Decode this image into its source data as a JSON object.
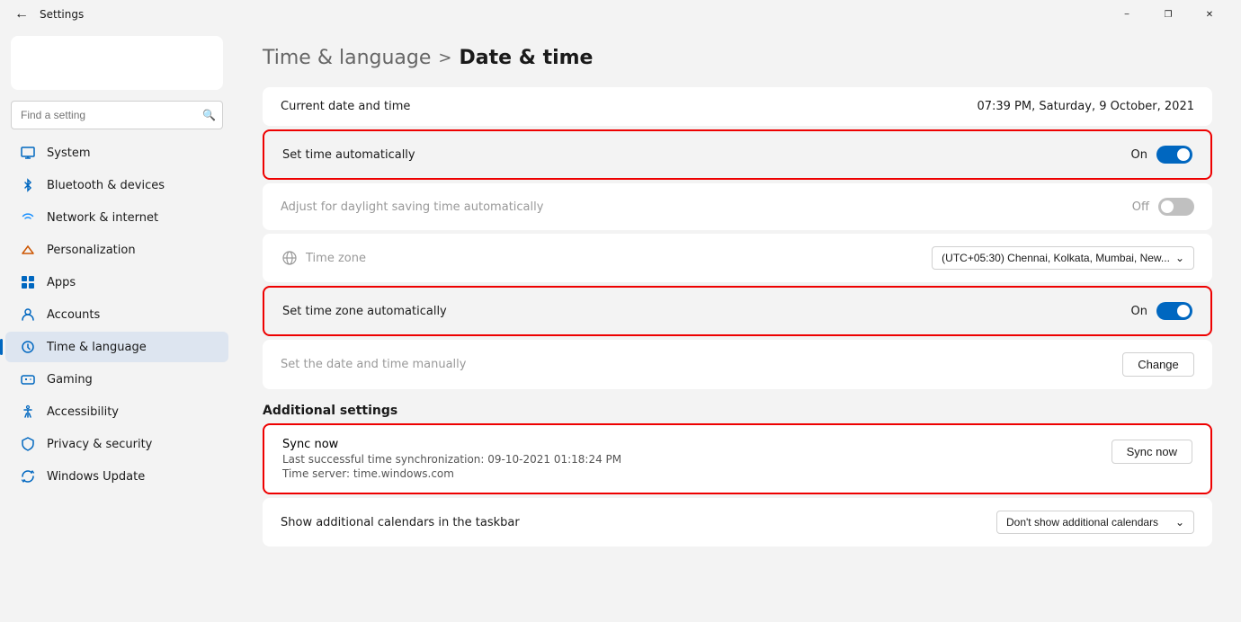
{
  "titlebar": {
    "title": "Settings",
    "minimize_label": "−",
    "restore_label": "❐",
    "close_label": "✕"
  },
  "sidebar": {
    "search_placeholder": "Find a setting",
    "items": [
      {
        "id": "system",
        "label": "System",
        "icon": "system"
      },
      {
        "id": "bluetooth",
        "label": "Bluetooth & devices",
        "icon": "bluetooth"
      },
      {
        "id": "network",
        "label": "Network & internet",
        "icon": "network"
      },
      {
        "id": "personalization",
        "label": "Personalization",
        "icon": "personalization"
      },
      {
        "id": "apps",
        "label": "Apps",
        "icon": "apps"
      },
      {
        "id": "accounts",
        "label": "Accounts",
        "icon": "accounts"
      },
      {
        "id": "time",
        "label": "Time & language",
        "icon": "time",
        "active": true
      },
      {
        "id": "gaming",
        "label": "Gaming",
        "icon": "gaming"
      },
      {
        "id": "accessibility",
        "label": "Accessibility",
        "icon": "accessibility"
      },
      {
        "id": "privacy",
        "label": "Privacy & security",
        "icon": "privacy"
      },
      {
        "id": "update",
        "label": "Windows Update",
        "icon": "update"
      }
    ]
  },
  "breadcrumb": {
    "parent": "Time & language",
    "separator": ">",
    "current": "Date & time"
  },
  "content": {
    "current_time_label": "Current date and time",
    "current_time_value": "07:39 PM, Saturday, 9 October, 2021",
    "set_time_auto_label": "Set time automatically",
    "set_time_auto_state": "On",
    "set_time_auto_on": true,
    "daylight_label": "Adjust for daylight saving time automatically",
    "daylight_state": "Off",
    "daylight_on": false,
    "timezone_label": "Time zone",
    "timezone_value": "(UTC+05:30) Chennai, Kolkata, Mumbai, New...",
    "set_timezone_auto_label": "Set time zone automatically",
    "set_timezone_auto_state": "On",
    "set_timezone_auto_on": true,
    "set_manual_label": "Set the date and time manually",
    "change_btn": "Change",
    "additional_settings_title": "Additional settings",
    "sync_title": "Sync now",
    "sync_sub1": "Last successful time synchronization: 09-10-2021 01:18:24 PM",
    "sync_sub2": "Time server: time.windows.com",
    "sync_now_btn": "Sync now",
    "show_calendars_label": "Show additional calendars in the taskbar",
    "show_calendars_value": "Don't show additional calendars"
  }
}
